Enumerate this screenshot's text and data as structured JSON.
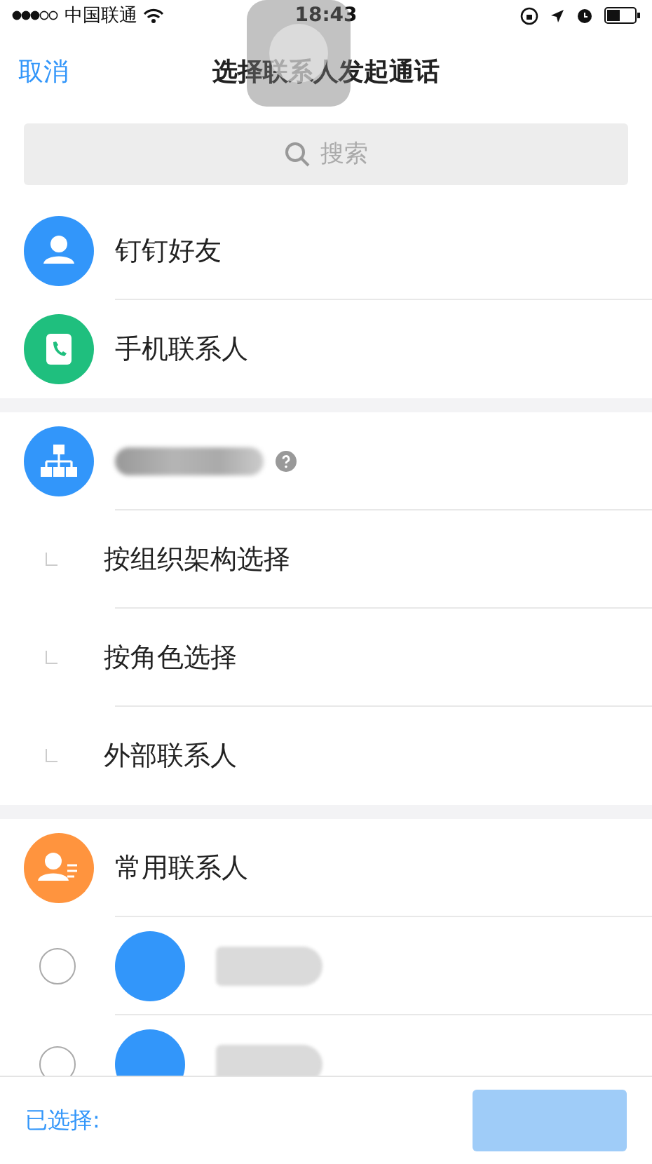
{
  "status_bar": {
    "carrier": "中国联通",
    "time": "18:43"
  },
  "nav": {
    "cancel": "取消",
    "title": "选择联系人发起通话"
  },
  "search": {
    "placeholder": "搜索"
  },
  "sources": [
    {
      "label": "钉钉好友",
      "kind": "friend"
    },
    {
      "label": "手机联系人",
      "kind": "phone"
    }
  ],
  "organization": {
    "name_hidden": true,
    "options": [
      {
        "label": "按组织架构选择"
      },
      {
        "label": "按角色选择"
      },
      {
        "label": "外部联系人"
      }
    ]
  },
  "frequent": {
    "label": "常用联系人",
    "contacts": [
      {
        "selected": false
      },
      {
        "selected": false
      }
    ]
  },
  "footer": {
    "selected_label": "已选择:"
  }
}
